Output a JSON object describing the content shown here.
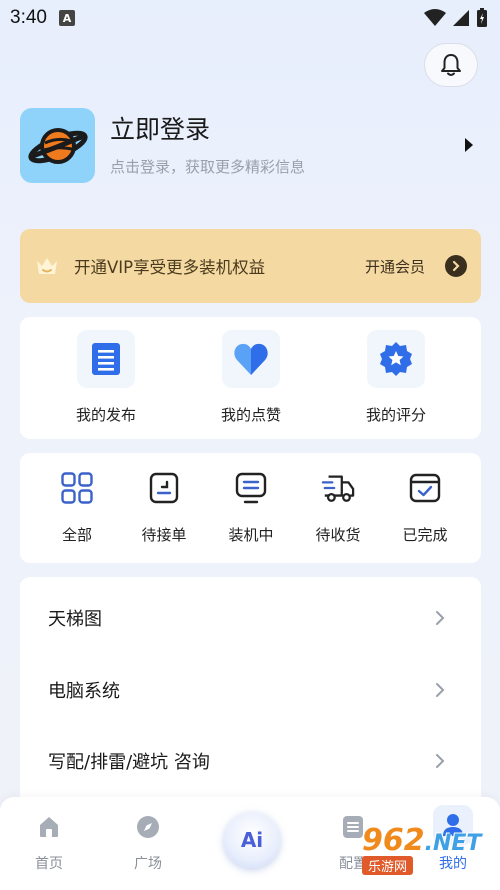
{
  "status": {
    "time": "3:40"
  },
  "header": {
    "title": "立即登录",
    "subtitle": "点击登录，获取更多精彩信息"
  },
  "vip": {
    "text": "开通VIP享受更多装机权益",
    "cta": "开通会员"
  },
  "quick": [
    {
      "label": "我的发布",
      "icon": "document-icon"
    },
    {
      "label": "我的点赞",
      "icon": "heart-icon"
    },
    {
      "label": "我的评分",
      "icon": "star-badge-icon"
    }
  ],
  "orders": [
    {
      "label": "全部",
      "icon": "grid-icon"
    },
    {
      "label": "待接单",
      "icon": "order-pending-icon"
    },
    {
      "label": "装机中",
      "icon": "monitor-icon"
    },
    {
      "label": "待收货",
      "icon": "truck-icon"
    },
    {
      "label": "已完成",
      "icon": "completed-box-icon"
    }
  ],
  "menu": [
    {
      "label": "天梯图"
    },
    {
      "label": "电脑系统"
    },
    {
      "label": "写配/排雷/避坑 咨询"
    }
  ],
  "tabs": [
    {
      "label": "首页",
      "icon": "home-icon"
    },
    {
      "label": "广场",
      "icon": "compass-icon"
    },
    {
      "label": "配置",
      "icon": "config-icon"
    },
    {
      "label": "我的",
      "icon": "user-icon"
    }
  ],
  "ai_button": {
    "label": "Ai"
  },
  "watermark": {
    "number": "962",
    "suffix": ".NET",
    "sub": "乐游网"
  },
  "colors": {
    "accent": "#2f6ee8",
    "vip_bg": "#f5d9a2",
    "avatar_bg": "#8fd3fb"
  }
}
